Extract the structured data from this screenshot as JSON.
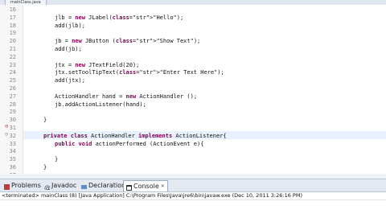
{
  "editor": {
    "tab_title": "mainClass.java",
    "lines": [
      {
        "num": "16",
        "text": ""
      },
      {
        "num": "17",
        "text": "jlb = new JLabel(\"Hello\");"
      },
      {
        "num": "18",
        "text": "add(jlb);"
      },
      {
        "num": "19",
        "text": ""
      },
      {
        "num": "20",
        "text": "jb = new JButton (\"Show Text\");"
      },
      {
        "num": "21",
        "text": "add(jb);"
      },
      {
        "num": "22",
        "text": ""
      },
      {
        "num": "23",
        "text": "jtx = new JTextField(20);"
      },
      {
        "num": "24",
        "text": "jtx.setToolTipText(\"Enter Text Here\");"
      },
      {
        "num": "25",
        "text": "add(jtx);"
      },
      {
        "num": "26",
        "text": ""
      },
      {
        "num": "27",
        "text": "ActionHandler hand = new ActionHandler ();"
      },
      {
        "num": "28",
        "text": "jb.addActionListener(hand);"
      },
      {
        "num": "29",
        "text": ""
      },
      {
        "num": "30",
        "text": "}"
      },
      {
        "num": "31",
        "text": ""
      },
      {
        "num": "32",
        "text": "private class ActionHandler implements ActionListener{"
      },
      {
        "num": "33",
        "text": "public void actionPerformed (ActionEvent e){"
      },
      {
        "num": "34",
        "text": ""
      },
      {
        "num": "35",
        "text": "}"
      },
      {
        "num": "36",
        "text": "}"
      },
      {
        "num": "37",
        "text": ""
      },
      {
        "num": "38",
        "text": "}"
      },
      {
        "num": "39",
        "text": ""
      }
    ]
  },
  "views": {
    "tabs": [
      {
        "label": "Problems",
        "icon": "problems-icon"
      },
      {
        "label": "Javadoc",
        "icon": "javadoc-icon"
      },
      {
        "label": "Declaration",
        "icon": "declaration-icon"
      },
      {
        "label": "Console",
        "icon": "console-icon",
        "close": "✕"
      }
    ]
  },
  "console": {
    "status": "<terminated> mainClass (8) [Java Application] C:\\Program Files\\Java\\jre6\\bin\\javaw.exe (Dec 10, 2011 3:26:16 PM)"
  }
}
